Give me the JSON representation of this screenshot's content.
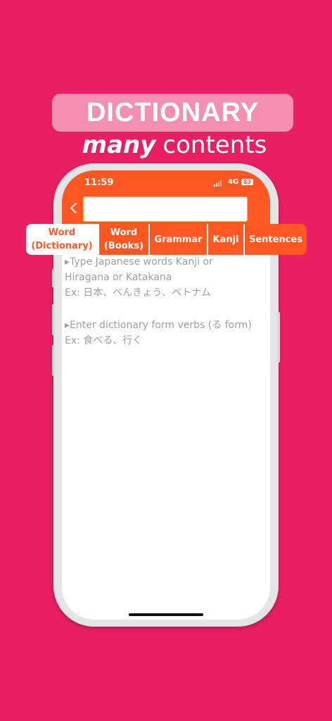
{
  "promo": {
    "headline": "DICTIONARY",
    "subline_emphasis": "many",
    "subline_rest": "contents"
  },
  "status_bar": {
    "time": "11:59",
    "network": "4G",
    "battery": "83"
  },
  "search": {
    "value": "",
    "placeholder": ""
  },
  "tabs": [
    {
      "line1": "Word",
      "line2": "(Dictionary)",
      "active": true
    },
    {
      "line1": "Word",
      "line2": "(Books)",
      "active": false
    },
    {
      "line1": "Grammar",
      "line2": "",
      "active": false
    },
    {
      "line1": "Kanji",
      "line2": "",
      "active": false
    },
    {
      "line1": "Sentences",
      "line2": "",
      "active": false
    }
  ],
  "hints": {
    "hint1_line1": "▸Type Japanese words Kanji or",
    "hint1_line2": "Hiragana or Katakana",
    "hint1_example": "Ex: 日本、べんきょう、ベトナム",
    "hint2_line1": "▸Enter dictionary form verbs (る form)",
    "hint2_example": "Ex: 食べる、行く"
  },
  "colors": {
    "background": "#e91e63",
    "accent": "#ff5722",
    "headline_box": "#f48fb1"
  }
}
